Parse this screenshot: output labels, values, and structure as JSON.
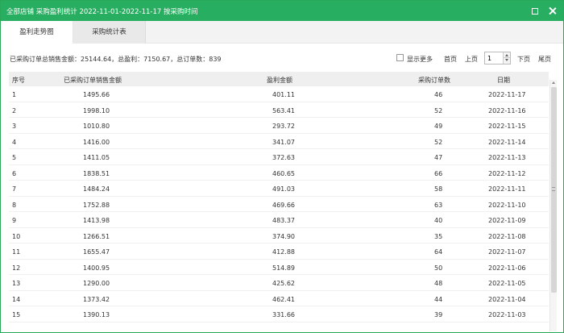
{
  "window": {
    "title": "全部店铺 采购盈利统计 2022-11-01-2022-11-17 按采购时间"
  },
  "tabs": [
    {
      "label": "盈利走势图"
    },
    {
      "label": "采购统计表"
    }
  ],
  "toolbar": {
    "summary": "已采购订单总销售金额：25144.64，总盈利：7150.67，总订单数：839",
    "show_more_label": "显示更多",
    "first_label": "首页",
    "prev_label": "上页",
    "page_value": "1",
    "next_label": "下页",
    "last_label": "尾页"
  },
  "table": {
    "columns": [
      "序号",
      "已采购订单销售金额",
      "盈利金额",
      "采购订单数",
      "日期"
    ],
    "rows": [
      [
        "1",
        "1495.66",
        "401.11",
        "46",
        "2022-11-17"
      ],
      [
        "2",
        "1998.10",
        "563.41",
        "52",
        "2022-11-16"
      ],
      [
        "3",
        "1010.80",
        "293.72",
        "49",
        "2022-11-15"
      ],
      [
        "4",
        "1416.00",
        "341.07",
        "52",
        "2022-11-14"
      ],
      [
        "5",
        "1411.05",
        "372.63",
        "47",
        "2022-11-13"
      ],
      [
        "6",
        "1838.51",
        "460.65",
        "66",
        "2022-11-12"
      ],
      [
        "7",
        "1484.24",
        "491.03",
        "58",
        "2022-11-11"
      ],
      [
        "8",
        "1752.88",
        "469.66",
        "63",
        "2022-11-10"
      ],
      [
        "9",
        "1413.98",
        "483.37",
        "40",
        "2022-11-09"
      ],
      [
        "10",
        "1266.51",
        "374.90",
        "35",
        "2022-11-08"
      ],
      [
        "11",
        "1655.47",
        "412.88",
        "64",
        "2022-11-07"
      ],
      [
        "12",
        "1400.95",
        "514.89",
        "50",
        "2022-11-06"
      ],
      [
        "13",
        "1290.00",
        "425.62",
        "48",
        "2022-11-05"
      ],
      [
        "14",
        "1373.42",
        "462.41",
        "44",
        "2022-11-04"
      ],
      [
        "15",
        "1390.13",
        "331.66",
        "39",
        "2022-11-03"
      ]
    ]
  },
  "colors": {
    "title_bar": "#27ae60",
    "header_bg": "#efefef"
  }
}
